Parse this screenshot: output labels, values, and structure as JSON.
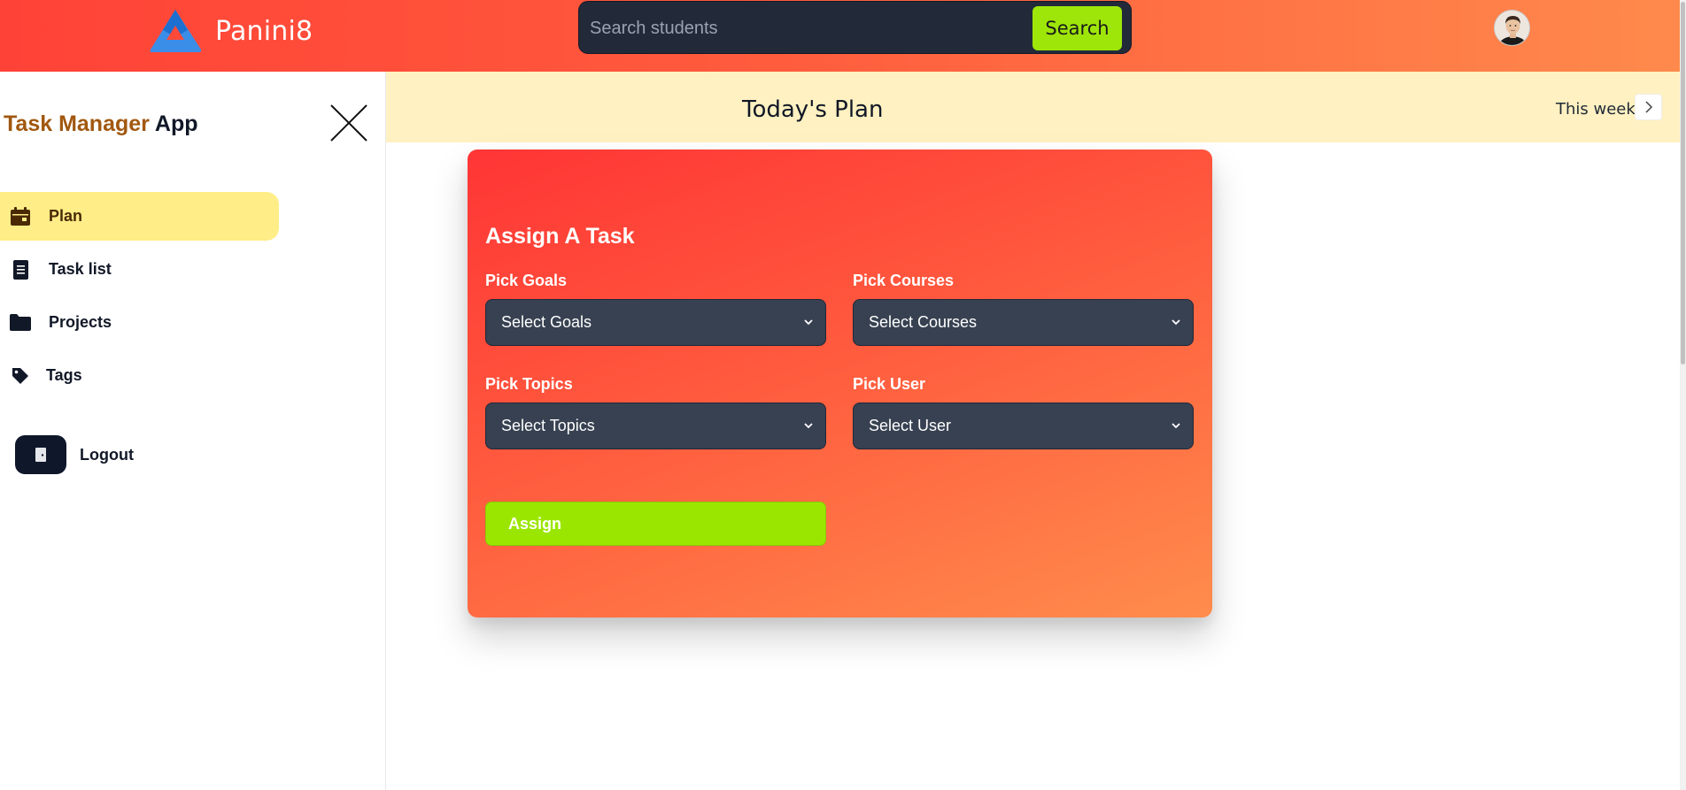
{
  "header": {
    "brand_name": "Panini8",
    "search_placeholder": "Search students",
    "search_button": "Search"
  },
  "sidebar": {
    "title_part1": "Task Manager",
    "title_part2": "App",
    "items": [
      {
        "label": "Plan",
        "icon": "calendar-icon",
        "active": true
      },
      {
        "label": "Task list",
        "icon": "document-icon",
        "active": false
      },
      {
        "label": "Projects",
        "icon": "folder-icon",
        "active": false
      },
      {
        "label": "Tags",
        "icon": "tag-icon",
        "active": false
      }
    ],
    "logout": "Logout"
  },
  "plan_bar": {
    "title": "Today's Plan",
    "week_label": "This week"
  },
  "assign_card": {
    "title": "Assign A Task",
    "goals_label": "Pick Goals",
    "goals_value": "Select Goals",
    "courses_label": "Pick Courses",
    "courses_value": "Select Courses",
    "topics_label": "Pick Topics",
    "topics_value": "Select Topics",
    "user_label": "Pick User",
    "user_value": "Select User",
    "assign_button": "Assign"
  },
  "colors": {
    "header_gradient_start": "#ff4237",
    "header_gradient_end": "#ff8a4c",
    "accent_green": "#9ee60a",
    "active_nav": "#ffed87",
    "plan_bar_bg": "#fff1c1",
    "select_bg": "#374151"
  }
}
